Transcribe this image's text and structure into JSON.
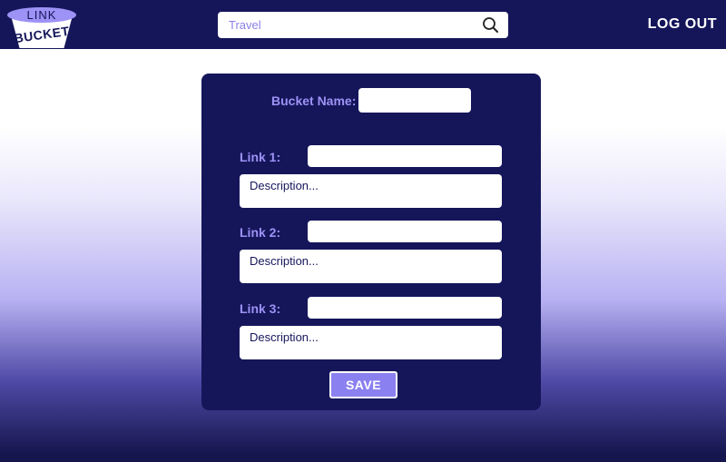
{
  "header": {
    "logo": {
      "line1": "LINK",
      "line2": "BUCKET"
    },
    "search": {
      "value": "Travel",
      "icon": "search-icon"
    },
    "logout_label": "LOG OUT"
  },
  "form": {
    "bucket_name_label": "Bucket Name:",
    "bucket_name_value": "",
    "links": [
      {
        "label": "Link 1:",
        "url_value": "",
        "description_placeholder": "Description..."
      },
      {
        "label": "Link 2:",
        "url_value": "",
        "description_placeholder": "Description..."
      },
      {
        "label": "Link 3:",
        "url_value": "",
        "description_placeholder": "Description..."
      }
    ],
    "save_label": "SAVE"
  },
  "colors": {
    "navy": "#15165a",
    "accent": "#9d92f5",
    "button": "#8a80f0",
    "white": "#ffffff"
  }
}
